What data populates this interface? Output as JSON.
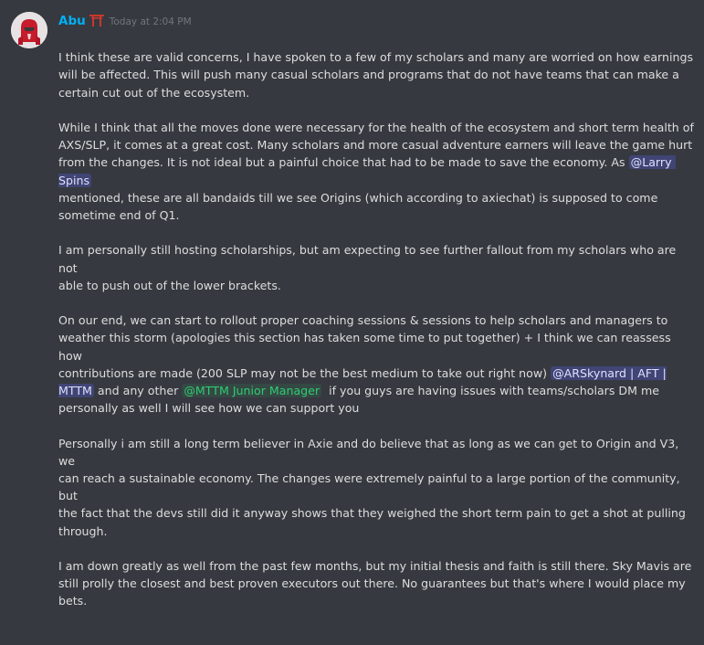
{
  "message": {
    "author": "Abu",
    "timestamp": "Today at 2:04 PM",
    "author_color": "#00b0f4",
    "paragraphs": {
      "p1": "I think these are valid concerns, I have spoken to a few of my scholars and many are worried on how earnings\nwill be affected. This will push many casual scholars and programs that do not have teams that can make a\ncertain cut out of the ecosystem.",
      "p2a": "While I think that all the moves done were necessary for the health of the ecosystem and short term health of\nAXS/SLP, it comes at a great cost. Many scholars and more casual adventure earners will leave the game hurt\nfrom the changes. It is not ideal but a painful choice that had to be made to save the economy. As ",
      "p2_mention": "@Larry Spins",
      "p2b": "\nmentioned, these are all bandaids till we see Origins (which according to axiechat) is supposed to come\nsometime end of Q1.",
      "p3": "I am personally still hosting scholarships, but am expecting to see further fallout from my scholars who are not\nable to push out of the lower brackets.",
      "p4a": "On our end, we can start to rollout proper coaching sessions & sessions to help scholars and managers to\nweather this storm (apologies this section has taken some time to put together) + I think we can reassess how\ncontributions are made (200 SLP may not be the best medium to take out right now) ",
      "p4_mention1": "@ARSkynard | AFT |\nMTTM",
      "p4b": " and any other ",
      "p4_role_mention": "@MTTM Junior Manager",
      "p4c": "  if you guys are having issues with teams/scholars DM me\npersonally as well I will see how we can support you",
      "p5": "Personally i am still a long term believer in Axie and do believe that as long as we can get to Origin and V3, we\ncan reach a sustainable economy. The changes were extremely painful to a large portion of the community, but\nthe fact that the devs still did it anyway shows that they weighed the short term pain to get a shot at pulling\nthrough.",
      "p6": "I am down greatly as well from the past few months, but my initial thesis and faith is still there. Sky Mavis are\nstill prolly the closest and best proven executors out there. No guarantees but that's where I would place my\nbets."
    }
  },
  "icons": {
    "avatar": "red-mask-avatar",
    "badge": "torii-gate-icon"
  },
  "colors": {
    "background": "#36393f",
    "text": "#dcddde",
    "timestamp": "#72767d",
    "user_mention_bg": "#414675",
    "role_mention": "#2ecc71"
  }
}
